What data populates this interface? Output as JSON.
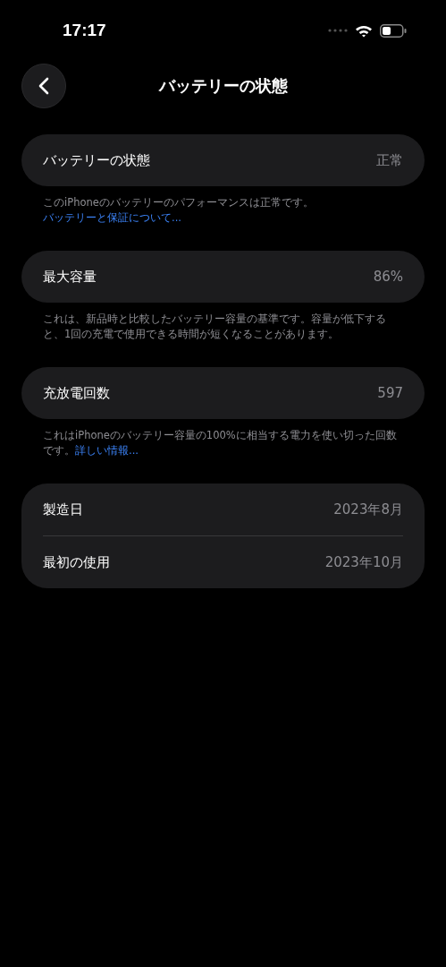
{
  "status_bar": {
    "time": "17:17"
  },
  "header": {
    "title": "バッテリーの状態"
  },
  "sections": [
    {
      "rows": [
        {
          "label": "バッテリーの状態",
          "value": "正常"
        }
      ],
      "footer": {
        "text": "このiPhoneのバッテリーのパフォーマンスは正常です。",
        "link": "バッテリーと保証について..."
      }
    },
    {
      "rows": [
        {
          "label": "最大容量",
          "value": "86%"
        }
      ],
      "footer": {
        "text": "これは、新品時と比較したバッテリー容量の基準です。容量が低下すると、1回の充電で使用できる時間が短くなることがあります。"
      }
    },
    {
      "rows": [
        {
          "label": "充放電回数",
          "value": "597"
        }
      ],
      "footer": {
        "text": "これはiPhoneのバッテリー容量の100%に相当する電力を使い切った回数です。",
        "link": "詳しい情報..."
      }
    },
    {
      "rows": [
        {
          "label": "製造日",
          "value": "2023年8月"
        },
        {
          "label": "最初の使用",
          "value": "2023年10月"
        }
      ]
    }
  ]
}
